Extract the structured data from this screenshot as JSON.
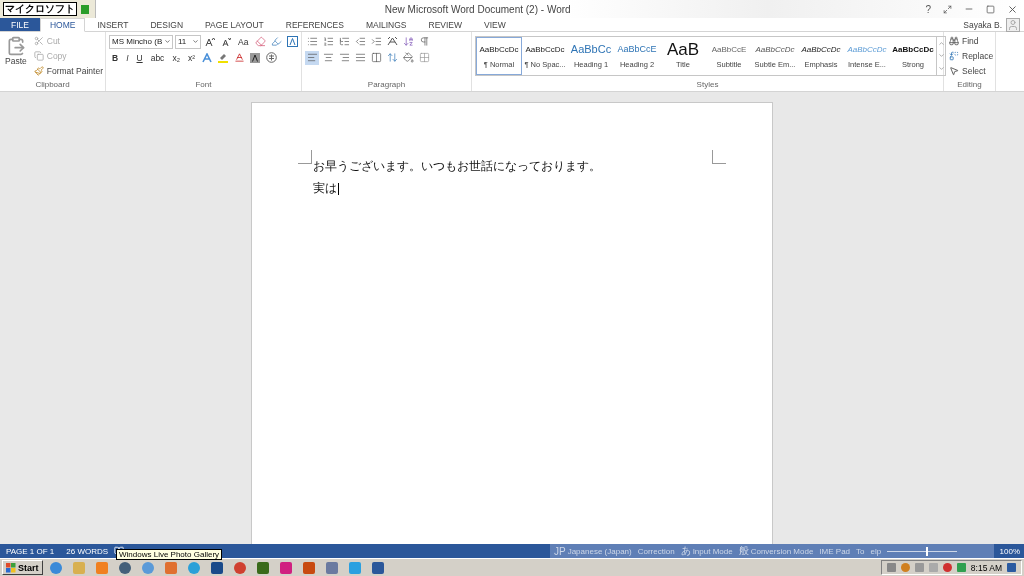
{
  "ime_toolbar": {
    "label": "マイクロソフト"
  },
  "window": {
    "title": "New Microsoft Word Document (2) - Word",
    "help": "?"
  },
  "tabs": [
    {
      "label": "FILE",
      "kind": "file",
      "selected": false
    },
    {
      "label": "HOME",
      "kind": "tab",
      "selected": true
    },
    {
      "label": "INSERT",
      "kind": "tab",
      "selected": false
    },
    {
      "label": "DESIGN",
      "kind": "tab",
      "selected": false
    },
    {
      "label": "PAGE LAYOUT",
      "kind": "tab",
      "selected": false
    },
    {
      "label": "REFERENCES",
      "kind": "tab",
      "selected": false
    },
    {
      "label": "MAILINGS",
      "kind": "tab",
      "selected": false
    },
    {
      "label": "REVIEW",
      "kind": "tab",
      "selected": false
    },
    {
      "label": "VIEW",
      "kind": "tab",
      "selected": false
    }
  ],
  "user": {
    "name": "Sayaka B."
  },
  "ribbon": {
    "clipboard": {
      "label": "Clipboard",
      "paste": "Paste",
      "cut": {
        "label": "Cut",
        "disabled": true
      },
      "copy": {
        "label": "Copy",
        "disabled": true
      },
      "format_painter": {
        "label": "Format Painter",
        "disabled": false
      }
    },
    "font": {
      "label": "Font",
      "font_name": "MS Mincho (B",
      "font_size": "11",
      "case_button": "Aa",
      "format_buttons": [
        "B",
        "I",
        "U",
        "abc",
        "x₂",
        "x²"
      ]
    },
    "paragraph": {
      "label": "Paragraph",
      "alignments": [
        {
          "kind": "left",
          "selected": true
        },
        {
          "kind": "center",
          "selected": false
        },
        {
          "kind": "right",
          "selected": false
        },
        {
          "kind": "justify",
          "selected": false
        },
        {
          "kind": "distributed",
          "selected": false
        }
      ]
    },
    "styles": {
      "label": "Styles",
      "items": [
        {
          "preview": "AaBbCcDc",
          "name": "¶ Normal",
          "kind": "normal",
          "selected": true
        },
        {
          "preview": "AaBbCcDc",
          "name": "¶ No Spac...",
          "kind": "normal",
          "selected": false
        },
        {
          "preview": "AaBbCc",
          "name": "Heading 1",
          "kind": "heading1",
          "selected": false
        },
        {
          "preview": "AaBbCcE",
          "name": "Heading 2",
          "kind": "heading2",
          "selected": false
        },
        {
          "preview": "AaB",
          "name": "Title",
          "kind": "title",
          "selected": false
        },
        {
          "preview": "AaBbCcE",
          "name": "Subtitle",
          "kind": "subtitle",
          "selected": false
        },
        {
          "preview": "AaBbCcDc",
          "name": "Subtle Em...",
          "kind": "subtle",
          "selected": false
        },
        {
          "preview": "AaBbCcDc",
          "name": "Emphasis",
          "kind": "emphasis",
          "selected": false
        },
        {
          "preview": "AaBbCcDc",
          "name": "Intense E...",
          "kind": "intense",
          "selected": false
        },
        {
          "preview": "AaBbCcDc",
          "name": "Strong",
          "kind": "strong",
          "selected": false
        }
      ]
    },
    "editing": {
      "label": "Editing",
      "find": "Find",
      "replace": "Replace",
      "select": "Select"
    }
  },
  "document": {
    "paragraphs": [
      "お早うございます。いつもお世話になっております。",
      "実は"
    ],
    "cursor": true
  },
  "status_bar": {
    "page": "PAGE 1 OF 1",
    "words": "26 WORDS",
    "zoom": "100%"
  },
  "tooltip": "Windows Live Photo Gallery",
  "language_bar": {
    "items": [
      {
        "icon": "JP",
        "label": "Japanese (Japan)"
      },
      {
        "label": "Correction"
      },
      {
        "icon": "あ",
        "label": "Input Mode"
      },
      {
        "icon": "般",
        "label": "Conversion Mode"
      },
      {
        "label": "IME Pad"
      },
      {
        "label": "To"
      },
      {
        "label": "elp"
      }
    ]
  },
  "zoom_slider": {
    "level": 0.55
  },
  "taskbar": {
    "start": "Start",
    "clock": "8:15 AM"
  }
}
